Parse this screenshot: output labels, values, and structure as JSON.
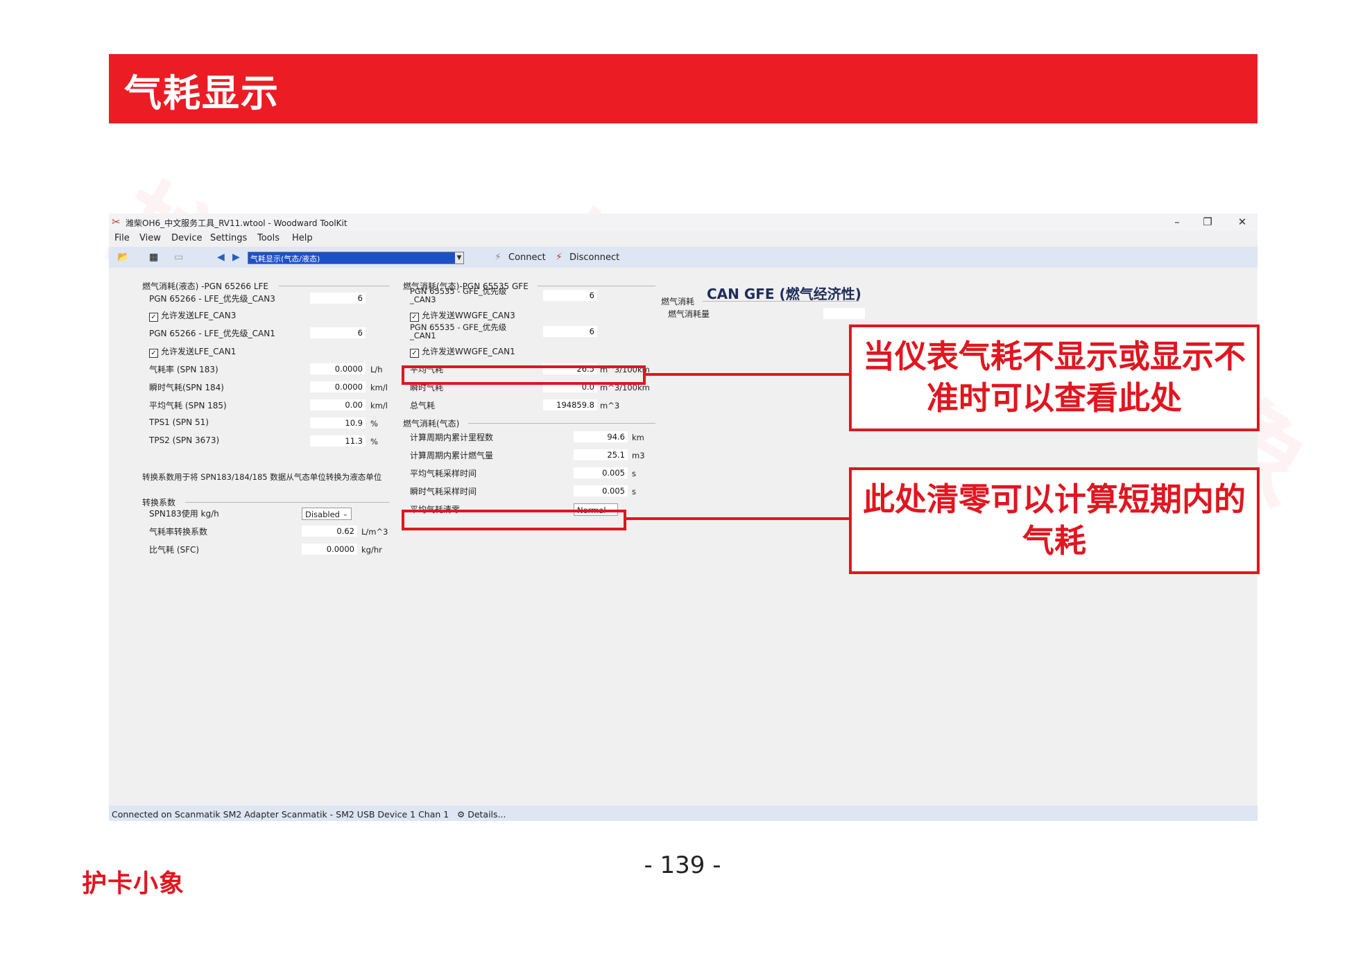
{
  "slide": {
    "title": "气耗显示",
    "page_number": "- 139 -",
    "logo": "护卡小象"
  },
  "colors": {
    "brand_red": "#ec1c24",
    "selection_blue": "#1c50c8",
    "toolbar_bg": "#dde6f2"
  },
  "window": {
    "title": "潍柴OH6_中文服务工具_RV11.wtool - Woodward ToolKit",
    "icon": "toolkit-app-icon",
    "controls": {
      "minimize": "–",
      "restore": "❐",
      "close": "✕"
    }
  },
  "menu": [
    "File",
    "View",
    "Device",
    "Settings",
    "Tools",
    "Help"
  ],
  "toolbar": {
    "page_select": "气耗显示(气态/液态)",
    "connect": "Connect",
    "disconnect": "Disconnect"
  },
  "lfe": {
    "group_title": "燃气消耗(液态) -PGN 65266  LFE",
    "can3_label": "PGN 65266 - LFE_优先级_CAN3",
    "can3_value": "6",
    "can3_enable": "允许发送LFE_CAN3",
    "can1_label": "PGN 65266 - LFE_优先级_CAN1",
    "can1_value": "6",
    "can1_enable": "允许发送LFE_CAN1",
    "rows": [
      {
        "label": "气耗率 (SPN 183)",
        "value": "0.0000",
        "unit": "L/h"
      },
      {
        "label": "瞬时气耗(SPN 184)",
        "value": "0.0000",
        "unit": "km/l"
      },
      {
        "label": "平均气耗 (SPN 185)",
        "value": "0.00",
        "unit": "km/l"
      },
      {
        "label": "TPS1 (SPN 51)",
        "value": "10.9",
        "unit": "%"
      },
      {
        "label": "TPS2 (SPN 3673)",
        "value": "11.3",
        "unit": "%"
      }
    ]
  },
  "conversion": {
    "note": "转换系数用于将 SPN183/184/185 数据从气态单位转换为液态单位",
    "group_title": "转换系数",
    "spn183_label": "SPN183使用 kg/h",
    "spn183_value": "Disabled",
    "rate_label": "气耗率转换系数",
    "rate_value": "0.62",
    "rate_unit": "L/m^3",
    "sfc_label": "比气耗 (SFC)",
    "sfc_value": "0.0000",
    "sfc_unit": "kg/hr"
  },
  "gfe": {
    "group_title": "燃气消耗(气态)-PGN 65535  GFE",
    "can3_label": "PGN 65535 - GFE_优先级_CAN3",
    "can3_value": "6",
    "can3_enable": "允许发送WWGFE_CAN3",
    "can1_label": "PGN 65535 - GFE_优先级_CAN1",
    "can1_value": "6",
    "can1_enable": "允许发送WWGFE_CAN1",
    "rows": [
      {
        "label": "平均气耗",
        "value": "26.5",
        "unit": "m^3/100km"
      },
      {
        "label": "瞬时气耗",
        "value": "0.0",
        "unit": "m^3/100km"
      },
      {
        "label": "总气耗",
        "value": "194859.8",
        "unit": "m^3"
      }
    ]
  },
  "gas": {
    "group_title": "燃气消耗(气态)",
    "rows": [
      {
        "label": "计算周期内累计里程数",
        "value": "94.6",
        "unit": "km"
      },
      {
        "label": "计算周期内累计燃气量",
        "value": "25.1",
        "unit": "m3"
      },
      {
        "label": "平均气耗采样时间",
        "value": "0.005",
        "unit": "s"
      },
      {
        "label": "瞬时气耗采样时间",
        "value": "0.005",
        "unit": "s"
      }
    ],
    "reset_label": "平均气耗清零",
    "reset_value": "Normal"
  },
  "can_gfe": {
    "header": "CAN GFE (燃气经济性)",
    "group_title": "燃气消耗",
    "item_label": "燃气消耗量"
  },
  "status": {
    "text": "Connected on Scanmatik SM2 Adapter Scanmatik - SM2 USB Device 1 Chan 1",
    "details": "Details..."
  },
  "callouts": {
    "top": "当仪表气耗不显示或显示不准时可以查看此处",
    "bottom": "此处清零可以计算短期内的气耗"
  }
}
